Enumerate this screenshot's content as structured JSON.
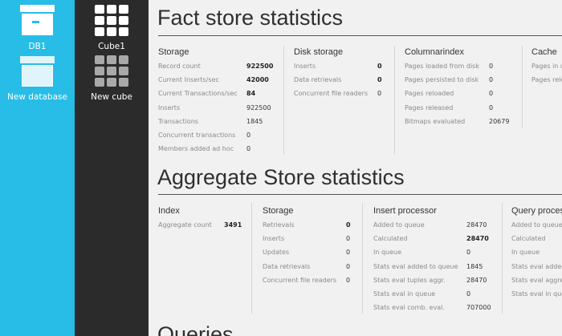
{
  "databases": [
    {
      "label": "DB1"
    },
    {
      "label": "New database"
    }
  ],
  "cubes": [
    {
      "label": "Cube1"
    },
    {
      "label": "New cube"
    }
  ],
  "fact": {
    "title": "Fact store statistics",
    "storage": {
      "title": "Storage",
      "rows": [
        {
          "k": "Record count",
          "v": "922500",
          "bold": true
        },
        {
          "k": "Current Inserts/sec",
          "v": "42000",
          "bold": true
        },
        {
          "k": "Current Transactions/sec",
          "v": "84",
          "bold": true
        },
        {
          "k": "Inserts",
          "v": "922500",
          "bold": false
        },
        {
          "k": "Transactions",
          "v": "1845",
          "bold": false
        },
        {
          "k": "Concurrent transactions",
          "v": "0",
          "bold": false
        },
        {
          "k": "Members added ad hoc",
          "v": "0",
          "bold": false
        }
      ]
    },
    "disk": {
      "title": "Disk storage",
      "rows": [
        {
          "k": "Inserts",
          "v": "0",
          "bold": true
        },
        {
          "k": "Data retrievals",
          "v": "0",
          "bold": true
        },
        {
          "k": "Concurrent file readers",
          "v": "0",
          "bold": false
        }
      ]
    },
    "columnar": {
      "title": "Columnarindex",
      "rows": [
        {
          "k": "Pages loaded from disk",
          "v": "0",
          "bold": false
        },
        {
          "k": "Pages persisted to disk",
          "v": "0",
          "bold": false
        },
        {
          "k": "Pages reloaded",
          "v": "0",
          "bold": false
        },
        {
          "k": "Pages released",
          "v": "0",
          "bold": false
        },
        {
          "k": "Bitmaps evaluated",
          "v": "20679",
          "bold": false
        }
      ]
    },
    "cache": {
      "title": "Cache",
      "rows": [
        {
          "k": "Pages in u",
          "v": "",
          "bold": false
        },
        {
          "k": "Pages rele",
          "v": "",
          "bold": false
        }
      ]
    }
  },
  "aggregate": {
    "title": "Aggregate Store statistics",
    "index": {
      "title": "Index",
      "rows": [
        {
          "k": "Aggregate count",
          "v": "3491",
          "bold": true
        }
      ]
    },
    "storage": {
      "title": "Storage",
      "rows": [
        {
          "k": "Retrievals",
          "v": "0",
          "bold": true
        },
        {
          "k": "Inserts",
          "v": "0",
          "bold": false
        },
        {
          "k": "Updates",
          "v": "0",
          "bold": false
        },
        {
          "k": "Data retrievals",
          "v": "0",
          "bold": false
        },
        {
          "k": "Concurrent file readers",
          "v": "0",
          "bold": false
        }
      ]
    },
    "insert": {
      "title": "Insert processor",
      "rows": [
        {
          "k": "Added to queue",
          "v": "28470",
          "bold": false
        },
        {
          "k": "Calculated",
          "v": "28470",
          "bold": true
        },
        {
          "k": "In queue",
          "v": "0",
          "bold": false
        },
        {
          "k": "Stats eval added to queue",
          "v": "1845",
          "bold": false
        },
        {
          "k": "Stats eval tuples aggr.",
          "v": "28470",
          "bold": false
        },
        {
          "k": "Stats eval in queue",
          "v": "0",
          "bold": false
        },
        {
          "k": "Stats eval comb. eval.",
          "v": "707000",
          "bold": false
        }
      ]
    },
    "query": {
      "title": "Query proces",
      "rows": [
        {
          "k": "Added to queue",
          "v": "",
          "bold": false
        },
        {
          "k": "Calculated",
          "v": "",
          "bold": false
        },
        {
          "k": "In queue",
          "v": "",
          "bold": false
        },
        {
          "k": "Stats eval added",
          "v": "",
          "bold": false
        },
        {
          "k": "Stats eval aggreg",
          "v": "",
          "bold": false
        },
        {
          "k": "Stats eval in que",
          "v": "",
          "bold": false
        }
      ]
    }
  },
  "queries": {
    "title": "Queries"
  }
}
